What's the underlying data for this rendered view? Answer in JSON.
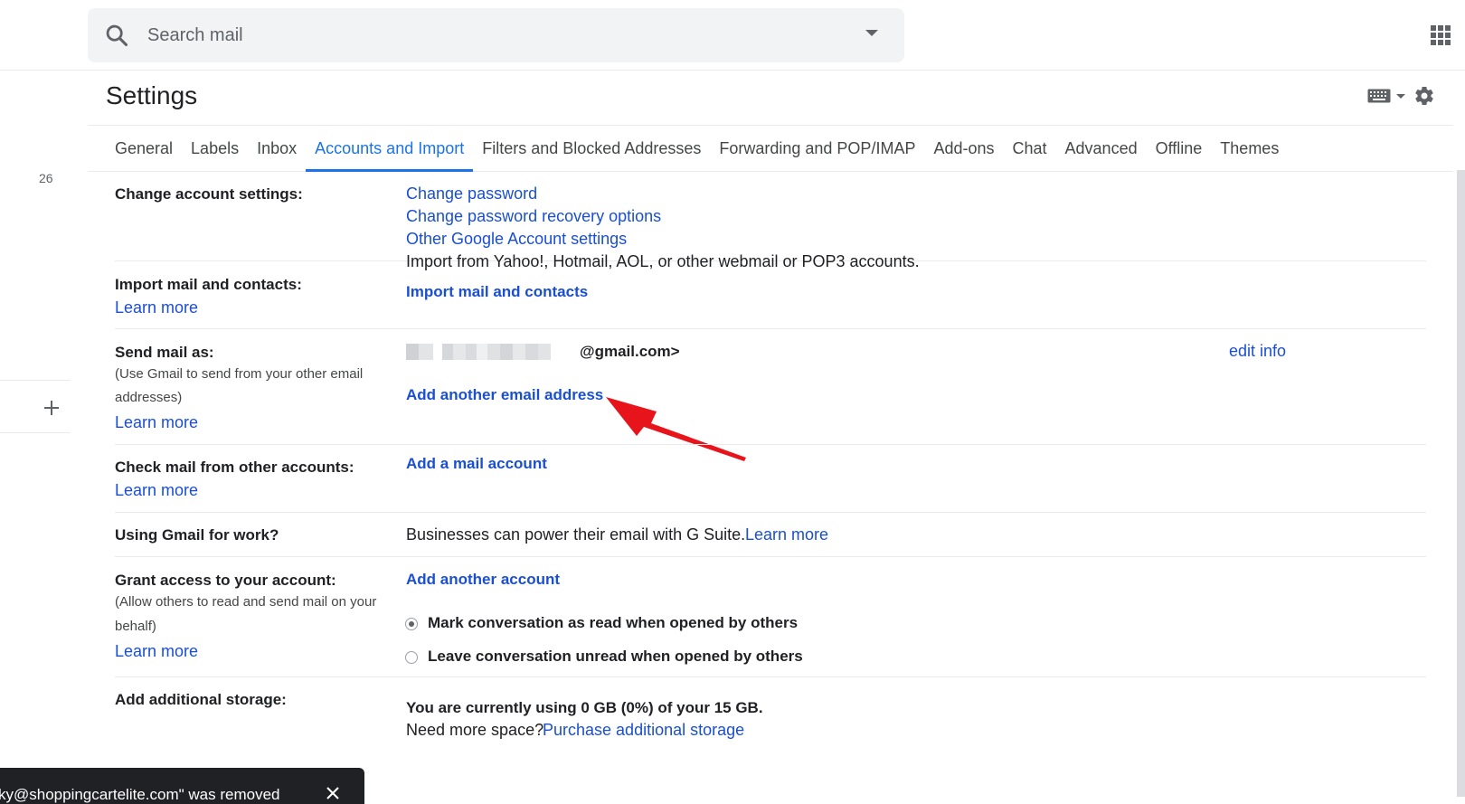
{
  "search": {
    "placeholder": "Search mail"
  },
  "settings": {
    "title": "Settings"
  },
  "tabs": [
    {
      "label": "General"
    },
    {
      "label": "Labels"
    },
    {
      "label": "Inbox"
    },
    {
      "label": "Accounts and Import",
      "active": true
    },
    {
      "label": "Filters and Blocked Addresses"
    },
    {
      "label": "Forwarding and POP/IMAP"
    },
    {
      "label": "Add-ons"
    },
    {
      "label": "Chat"
    },
    {
      "label": "Advanced"
    },
    {
      "label": "Offline"
    },
    {
      "label": "Themes"
    }
  ],
  "sidebar": {
    "count": "26"
  },
  "sections": {
    "change_account": {
      "label": "Change account settings:",
      "links": [
        "Change password",
        "Change password recovery options",
        "Other Google Account settings"
      ]
    },
    "import": {
      "label": "Import mail and contacts:",
      "learn_more": "Learn more",
      "description": "Import from Yahoo!, Hotmail, AOL, or other webmail or POP3 accounts.",
      "action": "Import mail and contacts"
    },
    "send_as": {
      "label": "Send mail as:",
      "sub1": "(Use Gmail to send from your other email",
      "sub2": "addresses)",
      "learn_more": "Learn more",
      "email_suffix": "@gmail.com>",
      "edit": "edit info",
      "action": "Add another email address"
    },
    "check_mail": {
      "label": "Check mail from other accounts:",
      "learn_more": "Learn more",
      "action": "Add a mail account"
    },
    "work": {
      "label": "Using Gmail for work?",
      "text": "Businesses can power their email with G Suite.",
      "learn_more": "Learn more"
    },
    "grant": {
      "label": "Grant access to your account:",
      "sub1": "(Allow others to read and send mail on your",
      "sub2": "behalf)",
      "learn_more": "Learn more",
      "action": "Add another account",
      "option1": "Mark conversation as read when opened by others",
      "option2": "Leave conversation unread when opened by others"
    },
    "storage": {
      "label": "Add additional storage:",
      "usage": "You are currently using 0 GB (0%) of your 15 GB.",
      "need": "Need more space?",
      "purchase": "Purchase additional storage"
    }
  },
  "toast": {
    "text": "ky@shoppingcartelite.com\" was removed"
  },
  "colors": {
    "link": "#1a4fd1",
    "active_tab": "#1a73e8",
    "arrow": "#e8141b",
    "toast_bg": "#202124"
  }
}
